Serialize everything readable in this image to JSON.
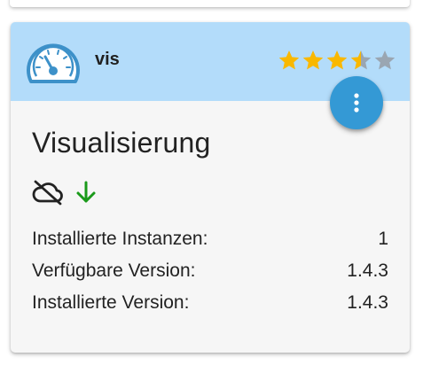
{
  "adapter": {
    "name": "vis",
    "title": "Visualisierung",
    "rating": 3.5,
    "rating_max": 5,
    "icon": "speedometer-icon"
  },
  "status": {
    "cloud_icon": "cloud-off-icon",
    "update_icon": "arrow-down-icon"
  },
  "menu": {
    "icon": "more-vert-icon"
  },
  "info": [
    {
      "label": "Installierte Instanzen:",
      "value": "1"
    },
    {
      "label": "Verfügbare Version:",
      "value": "1.4.3"
    },
    {
      "label": "Installierte Version:",
      "value": "1.4.3"
    }
  ],
  "colors": {
    "header_bg": "#b3dcfa",
    "card_bg": "#f6f6f6",
    "accent": "#3499d5",
    "star_filled": "#f9b800",
    "star_empty": "#9aa6b2",
    "update_arrow": "#1a9a1a"
  }
}
